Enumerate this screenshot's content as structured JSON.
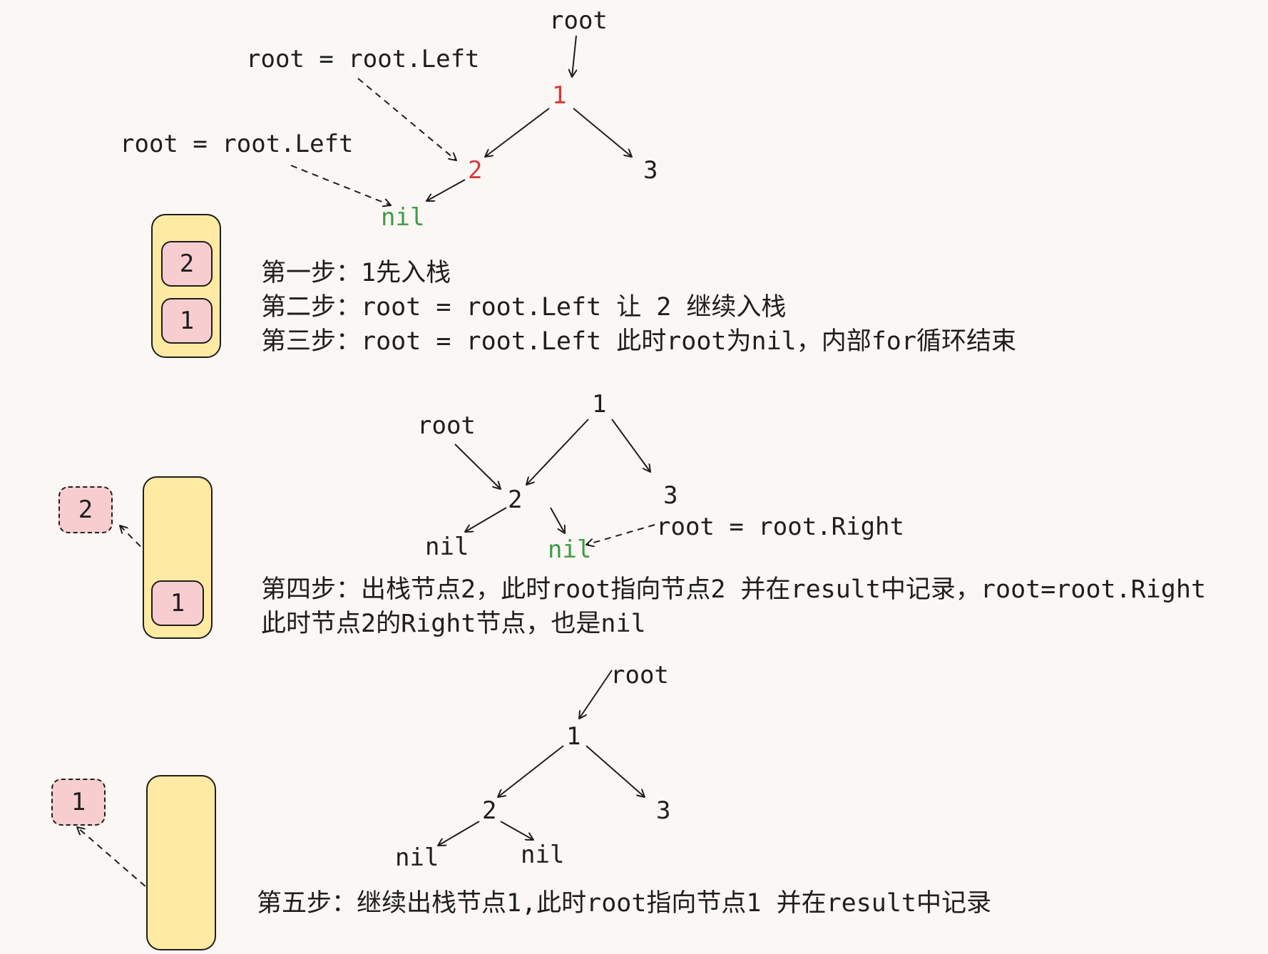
{
  "colors": {
    "background": "#faf7f4",
    "ink": "#1e1e1e",
    "highlight_red": "#d63a3a",
    "highlight_green": "#3e9c42",
    "stack_fill": "#ffeaa3",
    "item_fill": "#f7cdd0"
  },
  "panel1": {
    "root_label": "root",
    "assign_label_1": "root = root.Left",
    "assign_label_2": "root = root.Left",
    "nodes": {
      "n1": "1",
      "n2": "2",
      "n3": "3",
      "nil": "nil"
    },
    "stack": [
      "2",
      "1"
    ],
    "steps": [
      "第一步：1先入栈",
      "第二步：root = root.Left 让 2 继续入栈",
      "第三步：root = root.Left 此时root为nil，内部for循环结束"
    ]
  },
  "panel2": {
    "root_label": "root",
    "assign_label": "root = root.Right",
    "nodes": {
      "n1": "1",
      "n2": "2",
      "n3": "3",
      "nil_left": "nil",
      "nil_right": "nil"
    },
    "stack": [
      "1"
    ],
    "popped": "2",
    "steps": [
      "第四步：出栈节点2，此时root指向节点2 并在result中记录，root=root.Right",
      "此时节点2的Right节点，也是nil"
    ]
  },
  "panel3": {
    "root_label": "root",
    "nodes": {
      "n1": "1",
      "n2": "2",
      "n3": "3",
      "nil_left": "nil",
      "nil_right": "nil"
    },
    "stack": [],
    "popped": "1",
    "steps": [
      "第五步：继续出栈节点1,此时root指向节点1 并在result中记录"
    ]
  }
}
